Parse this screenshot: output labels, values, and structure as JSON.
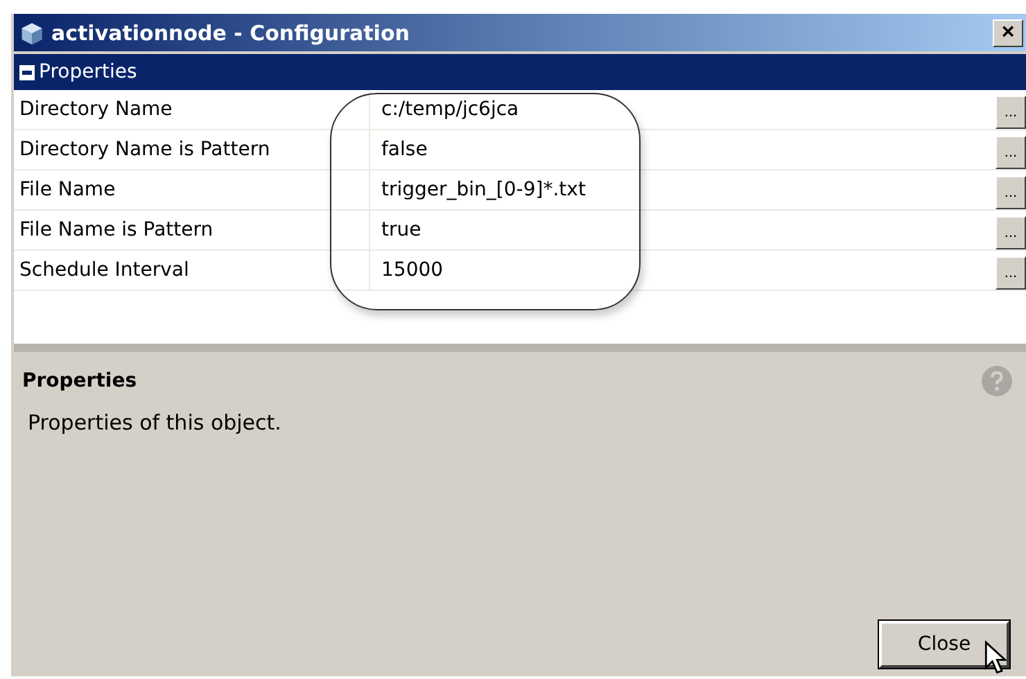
{
  "window": {
    "title": "activationnode - Configuration",
    "close_button": "×"
  },
  "section": {
    "label": "Properties",
    "expanded": true
  },
  "properties": [
    {
      "name": "Directory Name",
      "value": "c:/temp/jc6jca",
      "edit_button": "..."
    },
    {
      "name": "Directory Name is Pattern",
      "value": "false",
      "edit_button": "..."
    },
    {
      "name": "File Name",
      "value": "trigger_bin_[0-9]*.txt",
      "edit_button": "..."
    },
    {
      "name": "File Name is Pattern",
      "value": "true",
      "edit_button": "..."
    },
    {
      "name": "Schedule Interval",
      "value": "15000",
      "edit_button": "..."
    }
  ],
  "description": {
    "title": "Properties",
    "text": "Properties of this object."
  },
  "buttons": [
    "Close"
  ]
}
